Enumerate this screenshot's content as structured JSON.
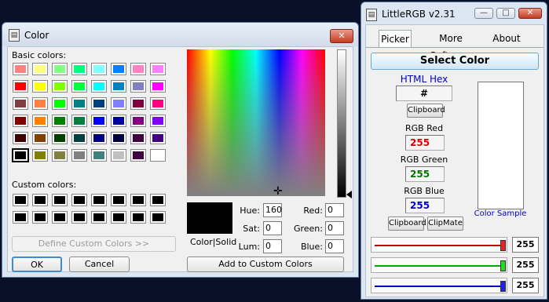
{
  "color_dialog": {
    "title": "Color",
    "close_glyph": "✕",
    "basic_colors_label": "Basic colors:",
    "custom_colors_label": "Custom colors:",
    "basic_colors": [
      [
        "#ff8080",
        "#ffff80",
        "#80ff80",
        "#00ff80",
        "#80ffff",
        "#0080ff",
        "#ff80c0",
        "#ff80ff"
      ],
      [
        "#ff0000",
        "#ffff00",
        "#80ff00",
        "#00ff40",
        "#00ffff",
        "#0080c0",
        "#8080c0",
        "#ff00ff"
      ],
      [
        "#804040",
        "#ff8040",
        "#00ff00",
        "#008080",
        "#004080",
        "#8080ff",
        "#800040",
        "#ff0080"
      ],
      [
        "#800000",
        "#ff8000",
        "#008000",
        "#008040",
        "#0000ff",
        "#0000a0",
        "#800080",
        "#8000ff"
      ],
      [
        "#400000",
        "#804000",
        "#004000",
        "#004040",
        "#000080",
        "#000040",
        "#400040",
        "#400080"
      ],
      [
        "#000000",
        "#808000",
        "#808040",
        "#808080",
        "#408080",
        "#c0c0c0",
        "#400040",
        "#ffffff"
      ]
    ],
    "selected_basic": "5-0",
    "custom_colors": [
      [
        "#000000",
        "#000000",
        "#000000",
        "#000000",
        "#000000",
        "#000000",
        "#000000",
        "#000000"
      ],
      [
        "#000000",
        "#000000",
        "#000000",
        "#000000",
        "#000000",
        "#000000",
        "#000000",
        "#000000"
      ]
    ],
    "define_custom_label": "Define Custom Colors >>",
    "ok_label": "OK",
    "cancel_label": "Cancel",
    "color_solid_label": "Color|Solid",
    "hue_label": "Hue:",
    "hue_value": "160",
    "sat_label": "Sat:",
    "sat_value": "0",
    "lum_label": "Lum:",
    "lum_value": "0",
    "red_label": "Red:",
    "red_value": "0",
    "green_label": "Green:",
    "green_value": "0",
    "blue_label": "Blue:",
    "blue_value": "0",
    "add_custom_label": "Add to Custom Colors"
  },
  "littlergb": {
    "title": "LittleRGB v2.31",
    "minimize_glyph": "—",
    "maximize_glyph": "□",
    "close_glyph": "✕",
    "tabs": [
      "Picker",
      "More Software",
      "About"
    ],
    "active_tab": "Picker",
    "select_color_label": "Select Color",
    "html_hex_label": "HTML Hex",
    "html_hex_value": "#",
    "clipboard_label": "Clipboard",
    "rgb_red_label": "RGB Red",
    "rgb_red_value": "255",
    "rgb_green_label": "RGB Green",
    "rgb_green_value": "255",
    "rgb_blue_label": "RGB Blue",
    "rgb_blue_value": "255",
    "clipboard2_label": "Clipboard",
    "clipmate_label": "ClipMate",
    "color_sample_label": "Color Sample",
    "sliders": [
      {
        "name": "red",
        "color": "#cc0000",
        "thumb": "#ee2222",
        "level": 1.0,
        "value": "255"
      },
      {
        "name": "green",
        "color": "#00aa00",
        "thumb": "#22dd22",
        "level": 1.0,
        "value": "255"
      },
      {
        "name": "blue",
        "color": "#0000cc",
        "thumb": "#2222ee",
        "level": 1.0,
        "value": "255"
      }
    ],
    "colors": {
      "red_text": "#dd0000",
      "green_text": "#007700",
      "blue_text": "#0000cc",
      "hex_label": "#0000cc"
    }
  }
}
